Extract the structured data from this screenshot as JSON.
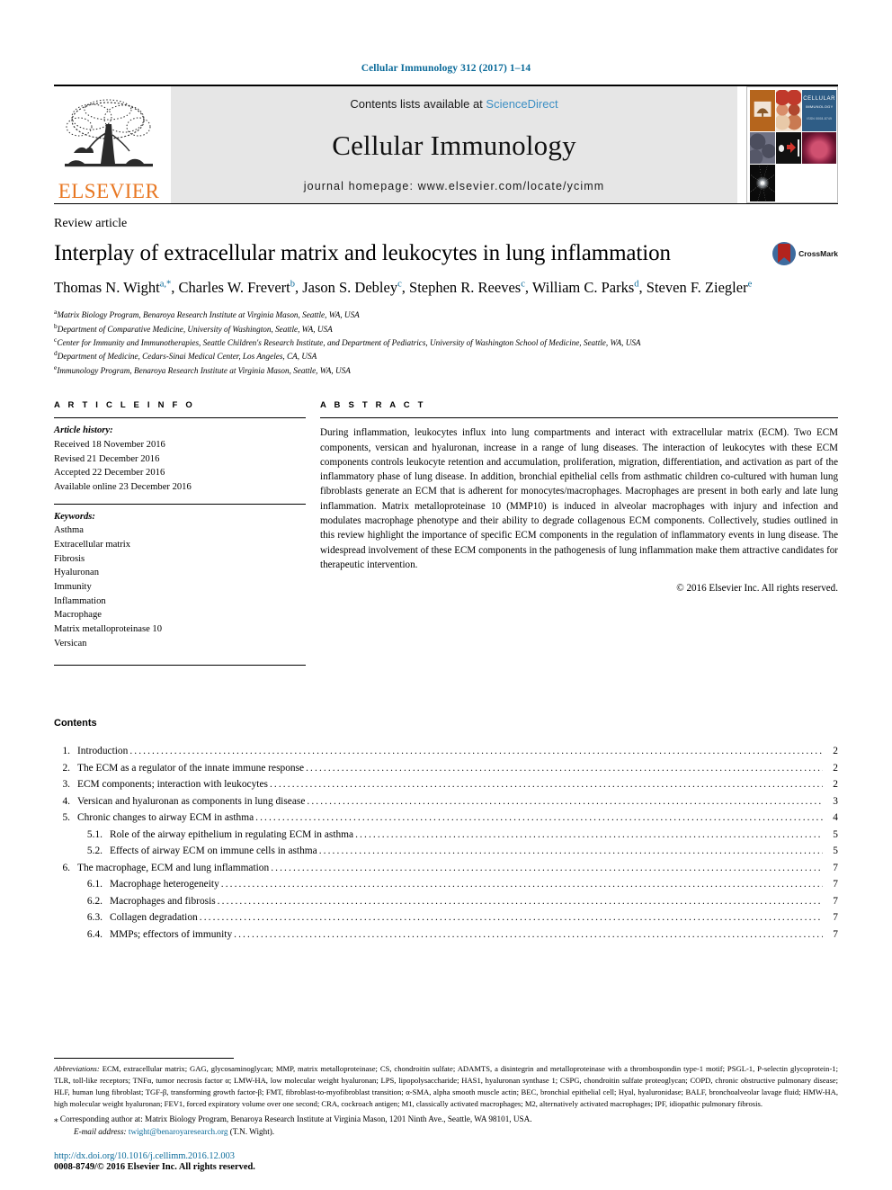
{
  "running_head": "Cellular Immunology 312 (2017) 1–14",
  "masthead": {
    "publisher_logo_text": "ELSEVIER",
    "contents_prefix": "Contents lists available at ",
    "contents_link": "ScienceDirect",
    "journal_title": "Cellular Immunology",
    "homepage": "journal homepage: www.elsevier.com/locate/ycimm",
    "cover": {
      "title_line1": "CELLULAR",
      "title_line2": "IMMUNOLOGY",
      "issn_line": "ISSN 0008-8749"
    }
  },
  "article": {
    "type": "Review article",
    "title": "Interplay of extracellular matrix and leukocytes in lung inflammation",
    "crossmark_label": "CrossMark",
    "authors_html": "Thomas N. Wight<sup>a,*</sup>, Charles W. Frevert<sup>b</sup>, Jason S. Debley<sup>c</sup>, Stephen R. Reeves<sup>c</sup>, William C. Parks<sup>d</sup>, Steven F. Ziegler<sup>e</sup>",
    "affiliations": [
      {
        "mark": "a",
        "text": "Matrix Biology Program, Benaroya Research Institute at Virginia Mason, Seattle, WA, USA"
      },
      {
        "mark": "b",
        "text": "Department of Comparative Medicine, University of Washington, Seattle, WA, USA"
      },
      {
        "mark": "c",
        "text": "Center for Immunity and Immunotherapies, Seattle Children's Research Institute, and Department of Pediatrics, University of Washington School of Medicine, Seattle, WA, USA"
      },
      {
        "mark": "d",
        "text": "Department of Medicine, Cedars-Sinai Medical Center, Los Angeles, CA, USA"
      },
      {
        "mark": "e",
        "text": "Immunology Program, Benaroya Research Institute at Virginia Mason, Seattle, WA, USA"
      }
    ]
  },
  "article_info": {
    "heading": "A R T I C L E  I N F O",
    "history_label": "Article history:",
    "history": [
      "Received 18 November 2016",
      "Revised 21 December 2016",
      "Accepted 22 December 2016",
      "Available online 23 December 2016"
    ],
    "keywords_label": "Keywords:",
    "keywords": [
      "Asthma",
      "Extracellular matrix",
      "Fibrosis",
      "Hyaluronan",
      "Immunity",
      "Inflammation",
      "Macrophage",
      "Matrix metalloproteinase 10",
      "Versican"
    ]
  },
  "abstract": {
    "heading": "A B S T R A C T",
    "body": "During inflammation, leukocytes influx into lung compartments and interact with extracellular matrix (ECM). Two ECM components, versican and hyaluronan, increase in a range of lung diseases. The interaction of leukocytes with these ECM components controls leukocyte retention and accumulation, proliferation, migration, differentiation, and activation as part of the inflammatory phase of lung disease. In addition, bronchial epithelial cells from asthmatic children co-cultured with human lung fibroblasts generate an ECM that is adherent for monocytes/macrophages. Macrophages are present in both early and late lung inflammation. Matrix metalloproteinase 10 (MMP10) is induced in alveolar macrophages with injury and infection and modulates macrophage phenotype and their ability to degrade collagenous ECM components. Collectively, studies outlined in this review highlight the importance of specific ECM components in the regulation of inflammatory events in lung disease. The widespread involvement of these ECM components in the pathogenesis of lung inflammation make them attractive candidates for therapeutic intervention.",
    "copyright": "© 2016 Elsevier Inc. All rights reserved."
  },
  "contents": {
    "heading": "Contents",
    "items": [
      {
        "num": "1.",
        "label": "Introduction",
        "page": "2",
        "sub": false
      },
      {
        "num": "2.",
        "label": "The ECM as a regulator of the innate immune response",
        "page": "2",
        "sub": false
      },
      {
        "num": "3.",
        "label": "ECM components; interaction with leukocytes",
        "page": "2",
        "sub": false
      },
      {
        "num": "4.",
        "label": "Versican and hyaluronan as components in lung disease",
        "page": "3",
        "sub": false
      },
      {
        "num": "5.",
        "label": "Chronic changes to airway ECM in asthma",
        "page": "4",
        "sub": false
      },
      {
        "num": "5.1.",
        "label": "Role of the airway epithelium in regulating ECM in asthma",
        "page": "5",
        "sub": true
      },
      {
        "num": "5.2.",
        "label": "Effects of airway ECM on immune cells in asthma",
        "page": "5",
        "sub": true
      },
      {
        "num": "6.",
        "label": "The macrophage, ECM and lung inflammation",
        "page": "7",
        "sub": false
      },
      {
        "num": "6.1.",
        "label": "Macrophage heterogeneity",
        "page": "7",
        "sub": true
      },
      {
        "num": "6.2.",
        "label": "Macrophages and fibrosis",
        "page": "7",
        "sub": true
      },
      {
        "num": "6.3.",
        "label": "Collagen degradation",
        "page": "7",
        "sub": true
      },
      {
        "num": "6.4.",
        "label": "MMPs; effectors of immunity",
        "page": "7",
        "sub": true
      }
    ]
  },
  "footnotes": {
    "abbreviations_label": "Abbreviations:",
    "abbreviations_text": " ECM, extracellular matrix; GAG, glycosaminoglycan; MMP, matrix metalloproteinase; CS, chondroitin sulfate; ADAMTS, a disintegrin and metalloproteinase with a thrombospondin type-1 motif; PSGL-1, P-selectin glycoprotein-1; TLR, toll-like receptors; TNFα, tumor necrosis factor α; LMW-HA, low molecular weight hyaluronan; LPS, lipopolysaccharide; HAS1, hyaluronan synthase 1; CSPG, chondroitin sulfate proteoglycan; COPD, chronic obstructive pulmonary disease; HLF, human lung fibroblast; TGF-β, transforming growth factor-β; FMT, fibroblast-to-myofibroblast transition; α-SMA, alpha smooth muscle actin; BEC, bronchial epithelial cell; Hyal, hyaluronidase; BALF, bronchoalveolar lavage fluid; HMW-HA, high molecular weight hyaluronan; FEV1, forced expiratory volume over one second; CRA, cockroach antigen; M1, classically activated macrophages; M2, alternatively activated macrophages; IPF, idiopathic pulmonary fibrosis.",
    "corresponding": "⁎ Corresponding author at: Matrix Biology Program, Benaroya Research Institute at Virginia Mason, 1201 Ninth Ave., Seattle, WA 98101, USA.",
    "email_label": "E-mail address:",
    "email": "twight@benaroyaresearch.org",
    "email_suffix": " (T.N. Wight).",
    "doi": "http://dx.doi.org/10.1016/j.cellimm.2016.12.003",
    "issn_copyright": "0008-8749/© 2016 Elsevier Inc. All rights reserved."
  },
  "colors": {
    "link": "#0b6b9a",
    "elsevier_orange": "#E87722",
    "band_gray": "#e6e6e6"
  }
}
